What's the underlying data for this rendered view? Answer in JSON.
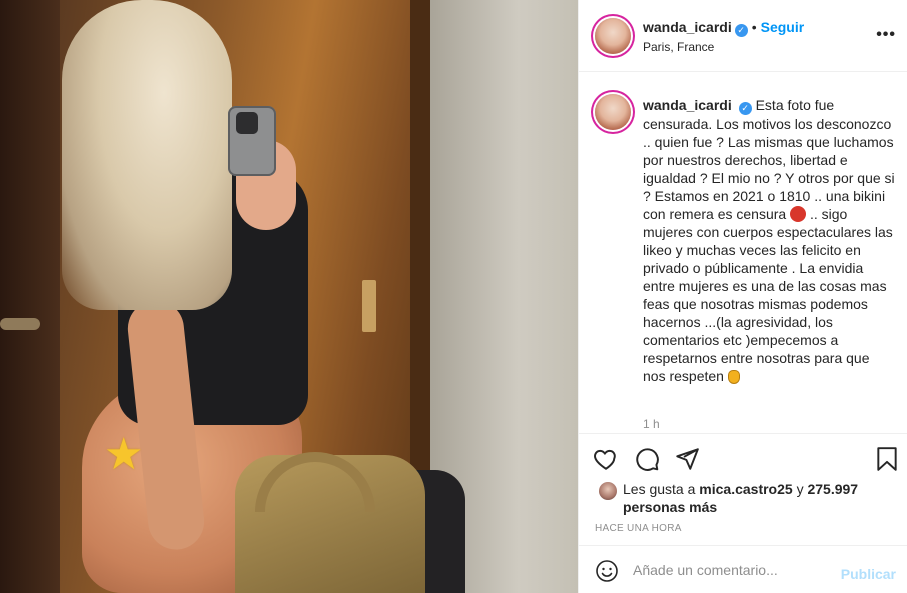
{
  "post": {
    "username": "wanda_icardi",
    "follow_label": "Seguir",
    "location": "Paris, France",
    "caption_username": "wanda_icardi",
    "caption_part1": "Esta foto fue censurada. Los motivos los desconozco .. quien fue ? Las mismas que luchamos por nuestros derechos, libertad e igualdad ? El mio no ? Y otros por que si ? Estamos en 2021 o 1810 .. una bikini con remera es censura",
    "caption_part2": ".. sigo mujeres con cuerpos espectaculares las likeo y muchas veces las felicito en privado o públicamente . La envidia entre mujeres es una de las cosas mas feas que nosotras mismas podemos hacernos ...(la agresividad, los comentarios etc )empecemos a respetarnos entre nosotras para que nos respeten",
    "time_ago": "1 h",
    "likes_prefix": "Les gusta a",
    "likes_user": "mica.castro25",
    "likes_and": "y",
    "likes_count": "275.997 personas más",
    "timestamp": "HACE UNA HORA",
    "comment_placeholder": "Añade un comentario...",
    "publish_label": "Publicar"
  },
  "icons": {
    "verified": "verified-badge-icon",
    "more": "more-options-icon",
    "like": "heart-icon",
    "comment": "comment-icon",
    "share": "paper-plane-icon",
    "save": "bookmark-icon",
    "emoji": "smiley-icon",
    "photo_sticker": "star-icon"
  },
  "colors": {
    "accent": "#0095f6",
    "publish_disabled": "#b2dffc",
    "verified": "#3897f0",
    "muted": "#8e8e8e"
  }
}
